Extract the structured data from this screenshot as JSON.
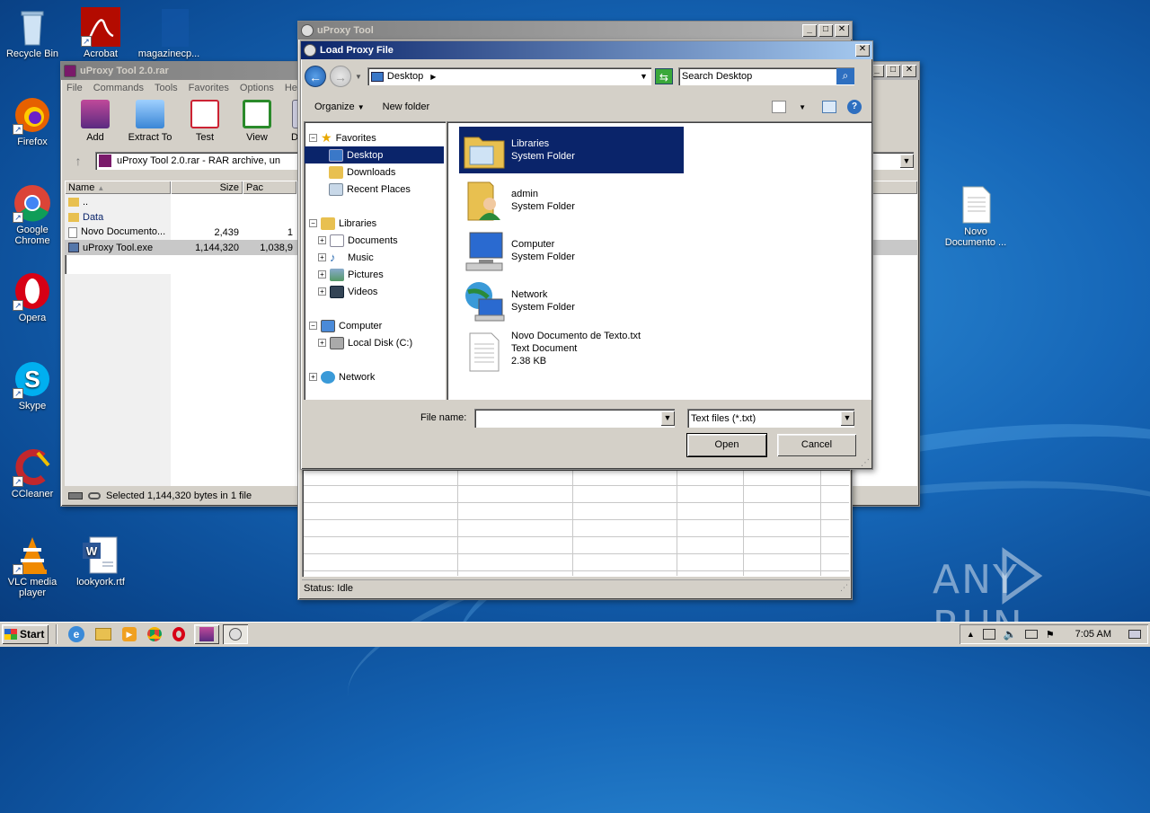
{
  "desktop": {
    "icons": [
      {
        "label": "Recycle Bin"
      },
      {
        "label": "Acrobat"
      },
      {
        "label": "magazinecp..."
      },
      {
        "label": "Firefox"
      },
      {
        "label": "Google Chrome"
      },
      {
        "label": "Opera"
      },
      {
        "label": "Skype"
      },
      {
        "label": "CCleaner"
      },
      {
        "label": "VLC media player"
      },
      {
        "label": "lookyork.rtf"
      },
      {
        "label": "Novo Documento ..."
      }
    ],
    "watermark": "ANY RUN"
  },
  "winrar": {
    "title": "uProxy Tool 2.0.rar",
    "menu": [
      "File",
      "Commands",
      "Tools",
      "Favorites",
      "Options",
      "Help"
    ],
    "toolbar": [
      "Add",
      "Extract To",
      "Test",
      "View",
      "De"
    ],
    "address": "uProxy Tool 2.0.rar - RAR archive, un",
    "columns": [
      "Name",
      "Size",
      "Pac"
    ],
    "rows": [
      {
        "name": "..",
        "size": "",
        "packed": ""
      },
      {
        "name": "Data",
        "size": "",
        "packed": ""
      },
      {
        "name": "Novo Documento...",
        "size": "2,439",
        "packed": "1"
      },
      {
        "name": "uProxy Tool.exe",
        "size": "1,144,320",
        "packed": "1,038,9"
      }
    ],
    "status": "Selected 1,144,320 bytes in 1 file"
  },
  "uproxy": {
    "title": "uProxy Tool",
    "status": "Status: Idle"
  },
  "dialog": {
    "title": "Load Proxy File",
    "location": "Desktop",
    "search_placeholder": "Search Desktop",
    "organize": "Organize",
    "new_folder": "New folder",
    "nav": {
      "favorites": "Favorites",
      "desktop": "Desktop",
      "downloads": "Downloads",
      "recent": "Recent Places",
      "libraries": "Libraries",
      "documents": "Documents",
      "music": "Music",
      "pictures": "Pictures",
      "videos": "Videos",
      "computer": "Computer",
      "localdisk": "Local Disk (C:)",
      "network": "Network"
    },
    "files": [
      {
        "name": "Libraries",
        "type": "System Folder",
        "size": ""
      },
      {
        "name": "admin",
        "type": "System Folder",
        "size": ""
      },
      {
        "name": "Computer",
        "type": "System Folder",
        "size": ""
      },
      {
        "name": "Network",
        "type": "System Folder",
        "size": ""
      },
      {
        "name": "Novo Documento de Texto.txt",
        "type": "Text Document",
        "size": "2.38 KB"
      }
    ],
    "filename_label": "File name:",
    "filename_value": "",
    "filter": "Text files (*.txt)",
    "open": "Open",
    "cancel": "Cancel"
  },
  "taskbar": {
    "start": "Start",
    "clock": "7:05 AM"
  },
  "colors": {
    "selection": "#0a246a",
    "title_active": "#0a246a",
    "desktop": "#1667b8"
  }
}
